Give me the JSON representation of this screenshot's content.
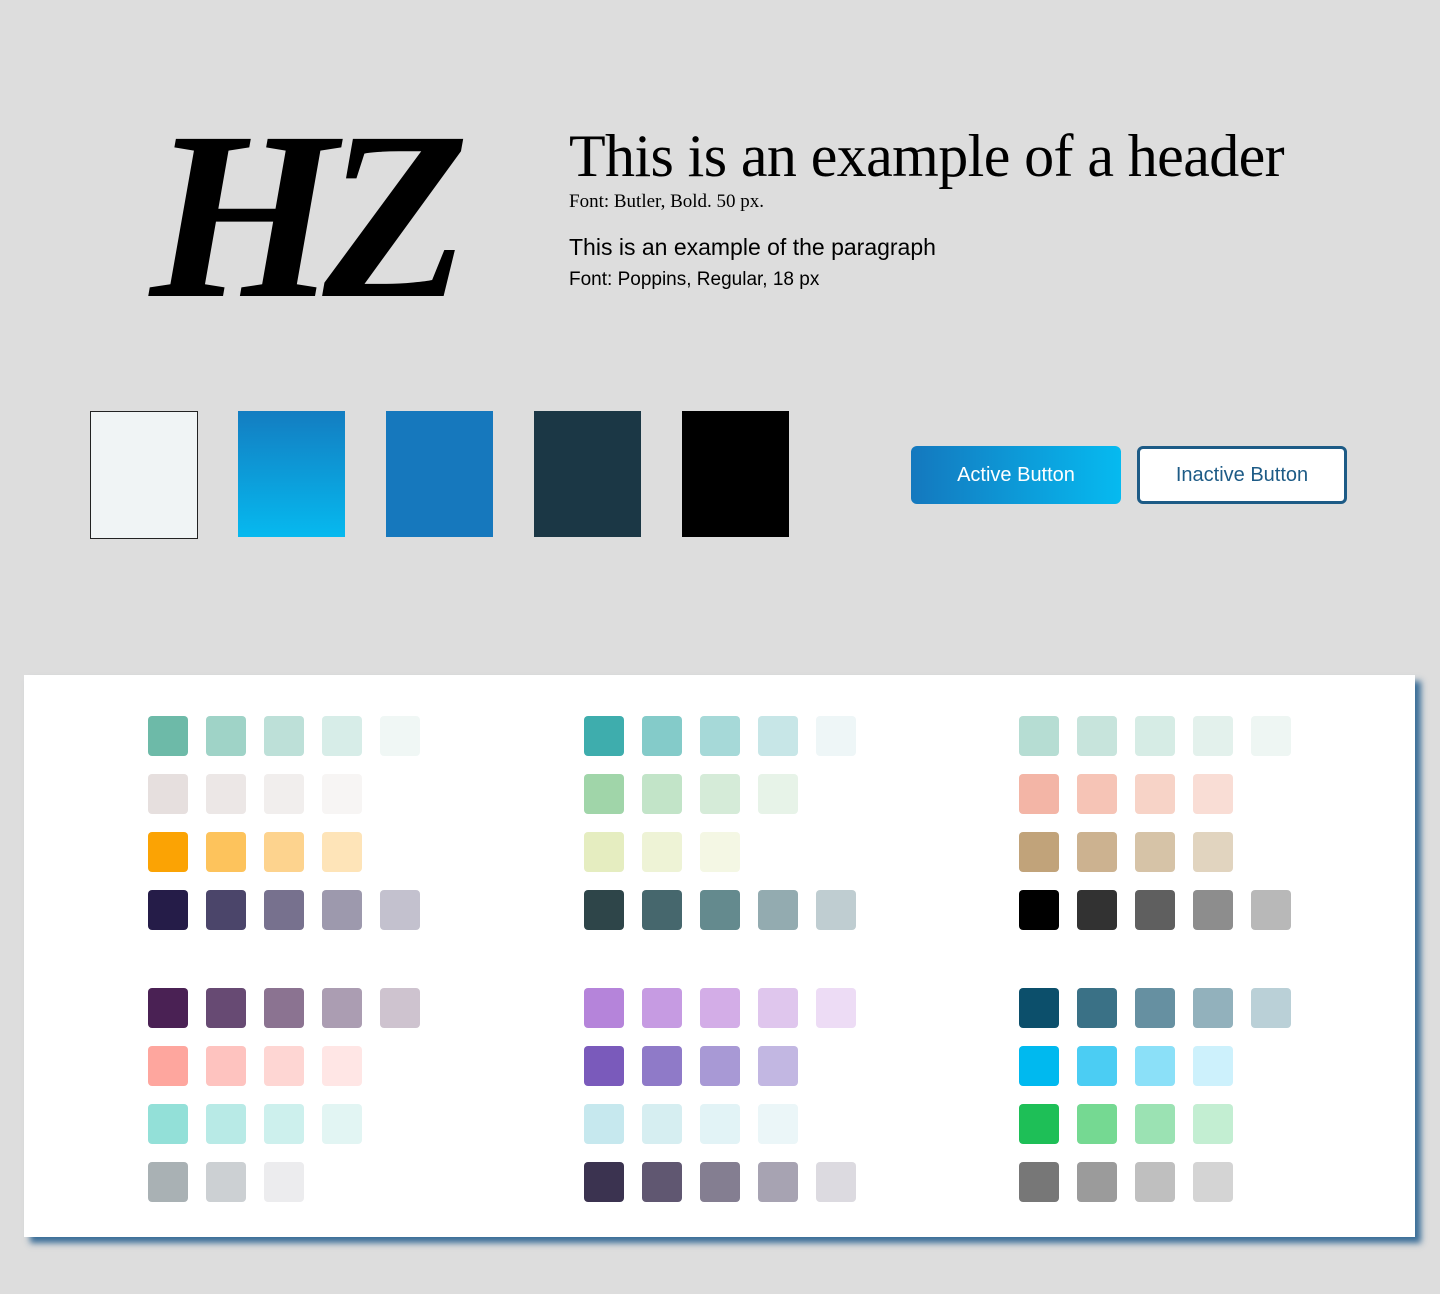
{
  "logo": {
    "text": "HZ"
  },
  "typography": {
    "header_example": "This is an example of a header",
    "header_font": "Font: Butler, Bold. 50 px.",
    "paragraph_example": "This is an example of the paragraph",
    "paragraph_font": "Font: Poppins, Regular, 18 px"
  },
  "primary_palette": [
    {
      "color": "#f0f4f5",
      "outlined": true
    },
    {
      "color": "linear-gradient(180deg,#137dc1,#06b9ef)",
      "gradient": [
        "#137dc1",
        "#06b9ef"
      ]
    },
    {
      "color": "#1678bd"
    },
    {
      "color": "#1b3745"
    },
    {
      "color": "#000000"
    }
  ],
  "buttons": {
    "active_label": "Active Button",
    "inactive_label": "Inactive Button",
    "active_gradient": [
      "#1478be",
      "#06baf0"
    ],
    "inactive_border": "#1d5b86"
  },
  "palette_groups": [
    [
      [
        "#6dbaa8",
        "#9fd3c7",
        "#bde0d8",
        "#d7ede8",
        "#f0f7f5"
      ],
      [
        "#e6dfde",
        "#ece7e6",
        "#f1eeed",
        "#f7f5f4"
      ],
      [
        "#fba304",
        "#fdc35c",
        "#fdd38e",
        "#fee4b8"
      ],
      [
        "#251c48",
        "#4b456a",
        "#77718e",
        "#9d99ad",
        "#c3c1ce"
      ]
    ],
    [
      [
        "#3eadad",
        "#84cbc9",
        "#a6d9d8",
        "#c7e6e7",
        "#eef6f7"
      ],
      [
        "#a0d5a9",
        "#c2e4c8",
        "#d5ebd8",
        "#e7f3e8"
      ],
      [
        "#e5edc0",
        "#eef3d6",
        "#f4f7e4"
      ],
      [
        "#2e4549",
        "#46676d",
        "#648a8e",
        "#93abb0",
        "#bfcdd1"
      ]
    ],
    [
      [
        "#b6ddd3",
        "#c7e4dc",
        "#d6ece5",
        "#e3f1ec",
        "#eef6f3"
      ],
      [
        "#f3b5a6",
        "#f6c4b6",
        "#f7d3c7",
        "#f9ddd5"
      ],
      [
        "#c1a37a",
        "#ccb290",
        "#d6c3a7",
        "#e1d4bf"
      ],
      [
        "#000000",
        "#323232",
        "#5f5f5f",
        "#8d8d8d",
        "#b8b8b8"
      ]
    ],
    [
      [
        "#4a2154",
        "#674a73",
        "#8b7391",
        "#ab9db2",
        "#cec3cf"
      ],
      [
        "#fea69e",
        "#fec3bf",
        "#fed6d3",
        "#ffe6e5"
      ],
      [
        "#93e0d8",
        "#b8eae6",
        "#cdf0ed",
        "#e2f5f3"
      ],
      [
        "#a9b1b4",
        "#ccd0d3",
        "#ececee"
      ]
    ],
    [
      [
        "#b584da",
        "#c69be2",
        "#d3ade7",
        "#dfc6ed",
        "#eddcf5"
      ],
      [
        "#7a5abb",
        "#8f7ac8",
        "#a899d5",
        "#c2b7e2"
      ],
      [
        "#c6e8ee",
        "#d6eef1",
        "#e2f3f6",
        "#ebf6f8"
      ],
      [
        "#3b3350",
        "#605771",
        "#847e91",
        "#a7a3b2",
        "#dcdae0"
      ]
    ],
    [
      [
        "#0c4f6b",
        "#3a7186",
        "#6690a1",
        "#92b1bc",
        "#bad0d7"
      ],
      [
        "#00b9ef",
        "#4bcdf3",
        "#8be0f8",
        "#cdf1fc"
      ],
      [
        "#1ebf57",
        "#75d992",
        "#9be2b3",
        "#c3eed2"
      ],
      [
        "#777777",
        "#9b9b9b",
        "#bfbfbf",
        "#d4d4d4"
      ]
    ]
  ]
}
